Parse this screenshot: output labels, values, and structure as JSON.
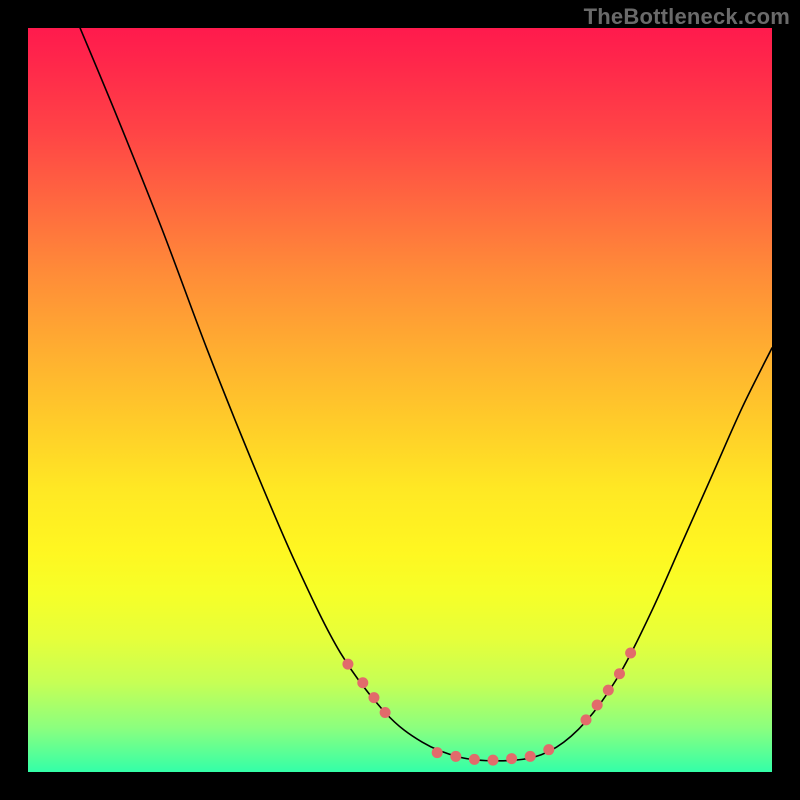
{
  "watermark": "TheBottleneck.com",
  "chart_data": {
    "type": "line",
    "title": "",
    "xlabel": "",
    "ylabel": "",
    "xlim": [
      0,
      100
    ],
    "ylim": [
      0,
      100
    ],
    "curve": [
      {
        "x": 7,
        "y": 100
      },
      {
        "x": 12,
        "y": 88
      },
      {
        "x": 18,
        "y": 73
      },
      {
        "x": 24,
        "y": 57
      },
      {
        "x": 30,
        "y": 42
      },
      {
        "x": 36,
        "y": 28
      },
      {
        "x": 42,
        "y": 16
      },
      {
        "x": 48,
        "y": 8
      },
      {
        "x": 53,
        "y": 4
      },
      {
        "x": 58,
        "y": 2
      },
      {
        "x": 63,
        "y": 1.5
      },
      {
        "x": 68,
        "y": 2
      },
      {
        "x": 72,
        "y": 4
      },
      {
        "x": 76,
        "y": 8
      },
      {
        "x": 80,
        "y": 14
      },
      {
        "x": 84,
        "y": 22
      },
      {
        "x": 88,
        "y": 31
      },
      {
        "x": 92,
        "y": 40
      },
      {
        "x": 96,
        "y": 49
      },
      {
        "x": 100,
        "y": 57
      }
    ],
    "points_left_branch": [
      {
        "x": 43,
        "y": 14.5
      },
      {
        "x": 45,
        "y": 12
      },
      {
        "x": 46.5,
        "y": 10
      },
      {
        "x": 48,
        "y": 8
      }
    ],
    "points_bottom": [
      {
        "x": 55,
        "y": 2.6
      },
      {
        "x": 57.5,
        "y": 2.1
      },
      {
        "x": 60,
        "y": 1.7
      },
      {
        "x": 62.5,
        "y": 1.6
      },
      {
        "x": 65,
        "y": 1.8
      },
      {
        "x": 67.5,
        "y": 2.1
      },
      {
        "x": 70,
        "y": 3.0
      }
    ],
    "points_right_branch": [
      {
        "x": 75,
        "y": 7
      },
      {
        "x": 76.5,
        "y": 9
      },
      {
        "x": 78,
        "y": 11
      },
      {
        "x": 79.5,
        "y": 13.2
      },
      {
        "x": 81,
        "y": 16
      }
    ]
  }
}
